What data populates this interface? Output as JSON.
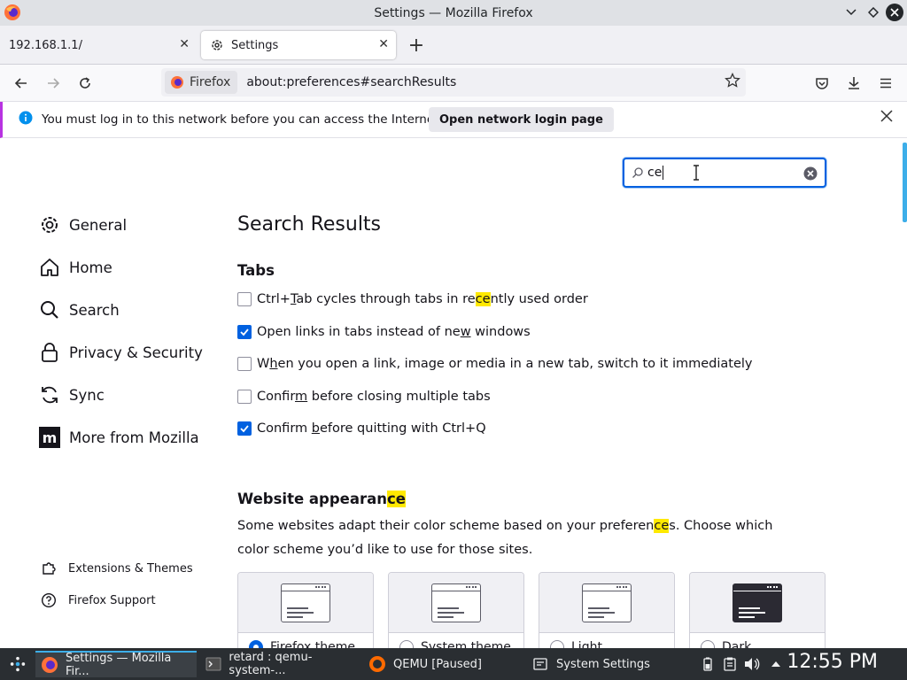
{
  "window": {
    "title": "Settings — Mozilla Firefox"
  },
  "tabs": [
    {
      "label": "192.168.1.1/"
    },
    {
      "label": "Settings"
    }
  ],
  "urlbar": {
    "identity_label": "Firefox",
    "url": "about:preferences#searchResults"
  },
  "notification": {
    "message": "You must log in to this network before you can access the Internet.",
    "button_label": "Open network login page"
  },
  "search": {
    "value": "ce"
  },
  "sidebar": {
    "items": [
      {
        "label": "General",
        "icon": "gear-icon"
      },
      {
        "label": "Home",
        "icon": "home-icon"
      },
      {
        "label": "Search",
        "icon": "search-icon"
      },
      {
        "label": "Privacy & Security",
        "icon": "lock-icon"
      },
      {
        "label": "Sync",
        "icon": "sync-icon"
      },
      {
        "label": "More from Mozilla",
        "icon": "mozilla-icon"
      }
    ],
    "footer": [
      {
        "label": "Extensions & Themes",
        "icon": "puzzle-icon"
      },
      {
        "label": "Firefox Support",
        "icon": "help-icon"
      }
    ]
  },
  "main": {
    "heading": "Search Results",
    "tabs_group": {
      "heading": "Tabs",
      "options": [
        {
          "text": "Ctrl+Tab cycles through tabs in recently used order",
          "checked": false
        },
        {
          "text": "Open links in tabs instead of new windows",
          "checked": true
        },
        {
          "text": "When you open a link, image or media in a new tab, switch to it immediately",
          "checked": false
        },
        {
          "text": "Confirm before closing multiple tabs",
          "checked": false
        },
        {
          "text": "Confirm before quitting with Ctrl+Q",
          "checked": true
        }
      ]
    },
    "appearance": {
      "heading": "Website appearance",
      "description": "Some websites adapt their color scheme based on your preferences. Choose which color scheme you'd like to use for those sites.",
      "themes": [
        {
          "label": "Firefox theme",
          "selected": true
        },
        {
          "label": "System theme",
          "selected": false
        },
        {
          "label": "Light",
          "selected": false
        },
        {
          "label": "Dark",
          "selected": false
        }
      ]
    }
  },
  "taskbar": {
    "items": [
      {
        "label": "Settings — Mozilla Fir..."
      },
      {
        "label": "retard : qemu-system-..."
      },
      {
        "label": "QEMU [Paused]"
      },
      {
        "label": "System Settings"
      }
    ],
    "clock": "12:55 PM"
  },
  "colors": {
    "accent": "#0061e0",
    "highlight": "#ffe900",
    "taskbar": "#2a2e32",
    "kde_blue": "#3daee9"
  }
}
